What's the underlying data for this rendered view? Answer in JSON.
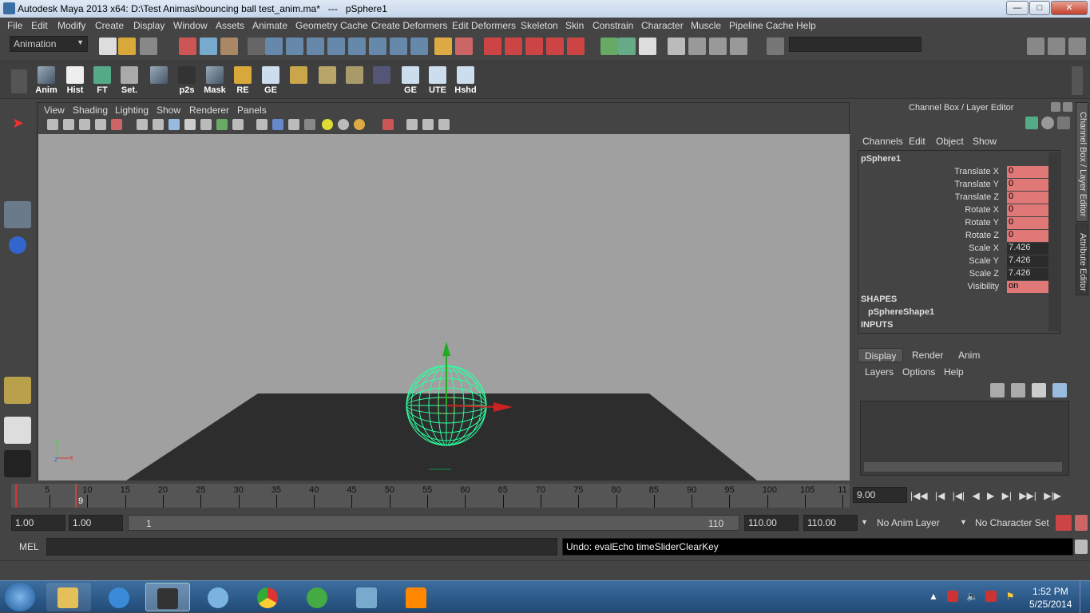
{
  "window": {
    "title": "Autodesk Maya 2013 x64: D:\\Test Animasi\\bouncing ball test_anim.ma*   ---   pSphere1",
    "min": "—",
    "max": "□",
    "close": "✕"
  },
  "menubar": [
    "File",
    "Edit",
    "Modify",
    "Create",
    "Display",
    "Window",
    "Assets",
    "Animate",
    "Geometry Cache",
    "Create Deformers",
    "Edit Deformers",
    "Skeleton",
    "Skin",
    "Constrain",
    "Character",
    "Muscle",
    "Pipeline Cache",
    "Help"
  ],
  "statusline": {
    "mode": "Animation",
    "search_value": ""
  },
  "shelf": [
    {
      "label": "Anim"
    },
    {
      "label": "Hist"
    },
    {
      "label": "FT"
    },
    {
      "label": "Set."
    },
    {
      "label": ""
    },
    {
      "label": "p2s"
    },
    {
      "label": "Mask"
    },
    {
      "label": "RE"
    },
    {
      "label": "GE"
    },
    {
      "label": ""
    },
    {
      "label": ""
    },
    {
      "label": ""
    },
    {
      "label": ""
    },
    {
      "label": "GE"
    },
    {
      "label": "UTE"
    },
    {
      "label": "Hshd"
    }
  ],
  "viewport": {
    "menu": [
      "View",
      "Shading",
      "Lighting",
      "Show",
      "Renderer",
      "Panels"
    ],
    "axis_y": "y",
    "axis_x": "x",
    "axis_z": "z"
  },
  "channel_box": {
    "header": "Channel Box / Layer Editor",
    "menu": [
      "Channels",
      "Edit",
      "Object",
      "Show"
    ],
    "object": "pSphere1",
    "channels": [
      {
        "name": "Translate X",
        "value": "0",
        "keyed": true
      },
      {
        "name": "Translate Y",
        "value": "0",
        "keyed": true
      },
      {
        "name": "Translate Z",
        "value": "0",
        "keyed": true
      },
      {
        "name": "Rotate X",
        "value": "0",
        "keyed": true
      },
      {
        "name": "Rotate Y",
        "value": "0",
        "keyed": true
      },
      {
        "name": "Rotate Z",
        "value": "0",
        "keyed": true
      },
      {
        "name": "Scale X",
        "value": "7.426",
        "keyed": false
      },
      {
        "name": "Scale Y",
        "value": "7.426",
        "keyed": false
      },
      {
        "name": "Scale Z",
        "value": "7.426",
        "keyed": false
      },
      {
        "name": "Visibility",
        "value": "on",
        "keyed": true
      }
    ],
    "shapes_label": "SHAPES",
    "shape_name": "pSphereShape1",
    "inputs_label": "INPUTS"
  },
  "side_tabs": {
    "channel_box": "Channel Box / Layer Editor",
    "attribute_editor": "Attribute Editor"
  },
  "layer_editor": {
    "tabs": [
      "Display",
      "Render",
      "Anim"
    ],
    "menu": [
      "Layers",
      "Options",
      "Help"
    ]
  },
  "time_slider": {
    "ticks": [
      "5",
      "10",
      "15",
      "20",
      "25",
      "30",
      "35",
      "40",
      "45",
      "50",
      "55",
      "60",
      "65",
      "70",
      "75",
      "80",
      "85",
      "90",
      "95",
      "100",
      "105",
      "11"
    ],
    "current_frame_marker": "9",
    "current_time": "9.00",
    "playback": [
      "|◀◀",
      "|◀",
      "|◀|",
      "◀",
      "▶",
      "▶|",
      "▶▶|",
      "▶|▶"
    ]
  },
  "range_slider": {
    "start_time": "1.00",
    "playback_start": "1.00",
    "range_start": "1",
    "range_end": "110",
    "playback_end": "110.00",
    "end_time": "110.00",
    "anim_layer": "No Anim Layer",
    "character_set": "No Character Set"
  },
  "command_line": {
    "label": "MEL",
    "input": "",
    "result": "Undo: evalEcho timeSliderClearKey"
  },
  "taskbar": {
    "time": "1:52 PM",
    "date": "5/25/2014"
  },
  "colors": {
    "keyed": "#e07878",
    "viewport_bg": "#a0a0a0",
    "ground": "#2d2d2d",
    "wire": "#2dffa0"
  }
}
